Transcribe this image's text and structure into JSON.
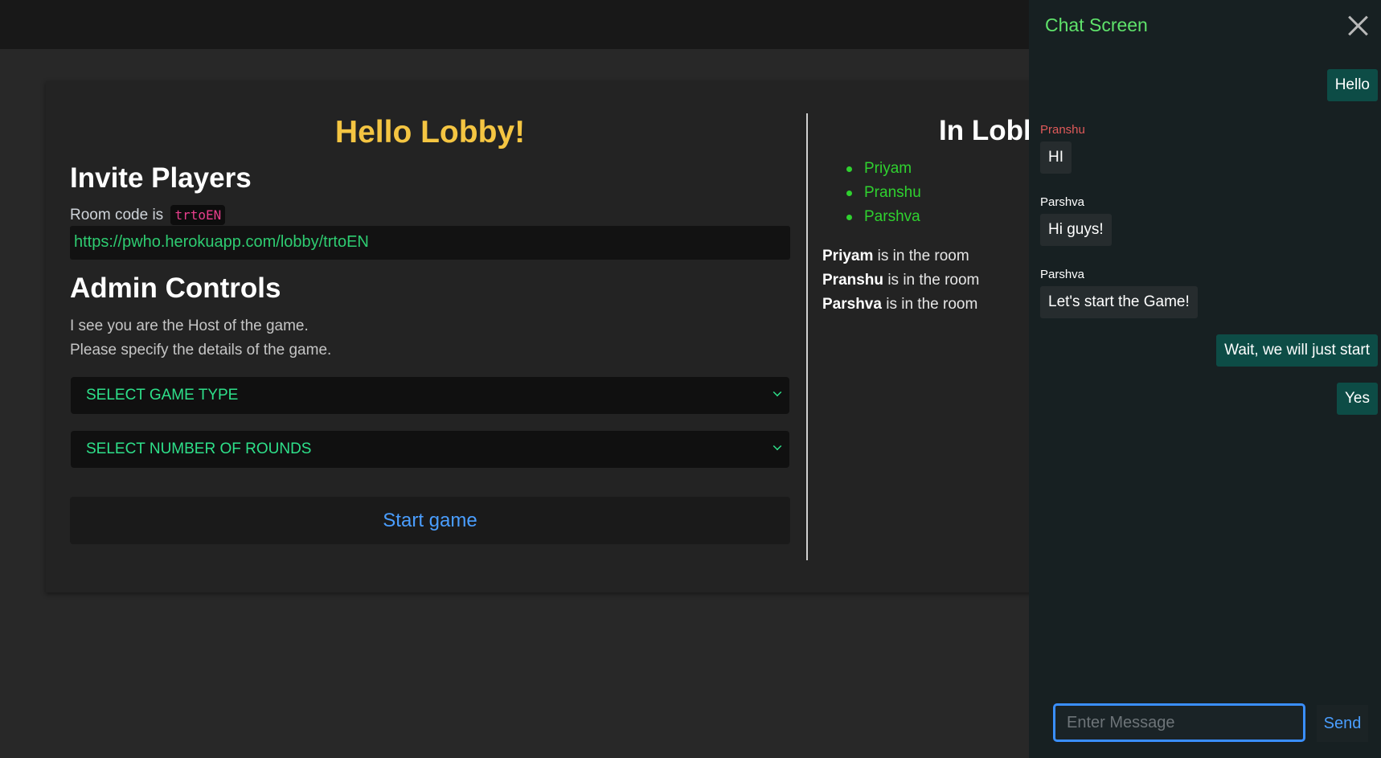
{
  "lobby": {
    "title": "Hello Lobby!",
    "invite_heading": "Invite Players",
    "room_code_prefix": "Room code is",
    "room_code": "trtoEN",
    "room_link": "https://pwho.herokuapp.com/lobby/trtoEN",
    "admin_heading": "Admin Controls",
    "host_line1": "I see you are the Host of the game.",
    "host_line2": "Please specify the details of the game.",
    "select_game_type": "SELECT GAME TYPE",
    "select_rounds": "SELECT NUMBER OF ROUNDS",
    "start_button": "Start game"
  },
  "in_lobby": {
    "title": "In Lobby",
    "players": [
      "Priyam",
      "Pranshu",
      "Parshva"
    ],
    "log_suffix": "is in the room"
  },
  "chat": {
    "title": "Chat Screen",
    "messages": [
      {
        "text": "Hello",
        "direction": "out"
      },
      {
        "sender": "Pranshu",
        "text": "HI",
        "direction": "in"
      },
      {
        "sender": "Parshva",
        "text": "Hi guys!",
        "direction": "in"
      },
      {
        "sender": "Parshva",
        "text": "Let's start the Game!",
        "direction": "in"
      },
      {
        "text": "Wait, we will just start",
        "direction": "out"
      },
      {
        "text": "Yes",
        "direction": "out"
      }
    ],
    "input_placeholder": "Enter Message",
    "send_button": "Send"
  },
  "colors": {
    "accent_yellow": "#f4c542",
    "accent_green": "#2ee08a",
    "link_blue": "#4a9eff",
    "chat_bg": "#172022"
  },
  "icons": {
    "close": "close-icon",
    "chevron": "chevron-down-icon"
  }
}
